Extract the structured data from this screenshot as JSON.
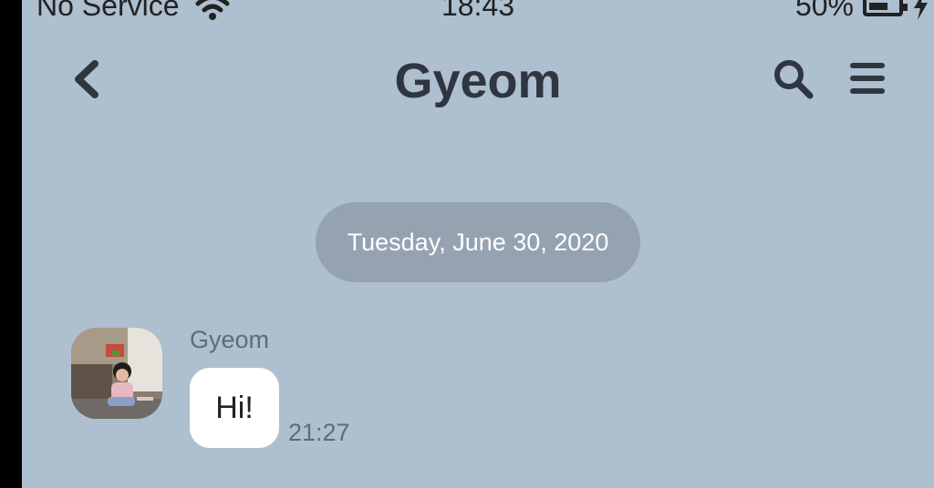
{
  "status_bar": {
    "carrier": "No Service",
    "time": "18:43",
    "battery": "50%"
  },
  "header": {
    "title": "Gyeom",
    "back_icon": "chevron-left-icon",
    "search_icon": "search-icon",
    "menu_icon": "menu-icon"
  },
  "chat": {
    "date_separator": "Tuesday, June 30, 2020",
    "messages": [
      {
        "sender": "Gyeom",
        "text": "Hi!",
        "time": "21:27"
      }
    ]
  },
  "colors": {
    "background": "#aebfcf",
    "date_pill": "#95a3b1",
    "bubble": "#ffffff",
    "title": "#2f3640"
  }
}
